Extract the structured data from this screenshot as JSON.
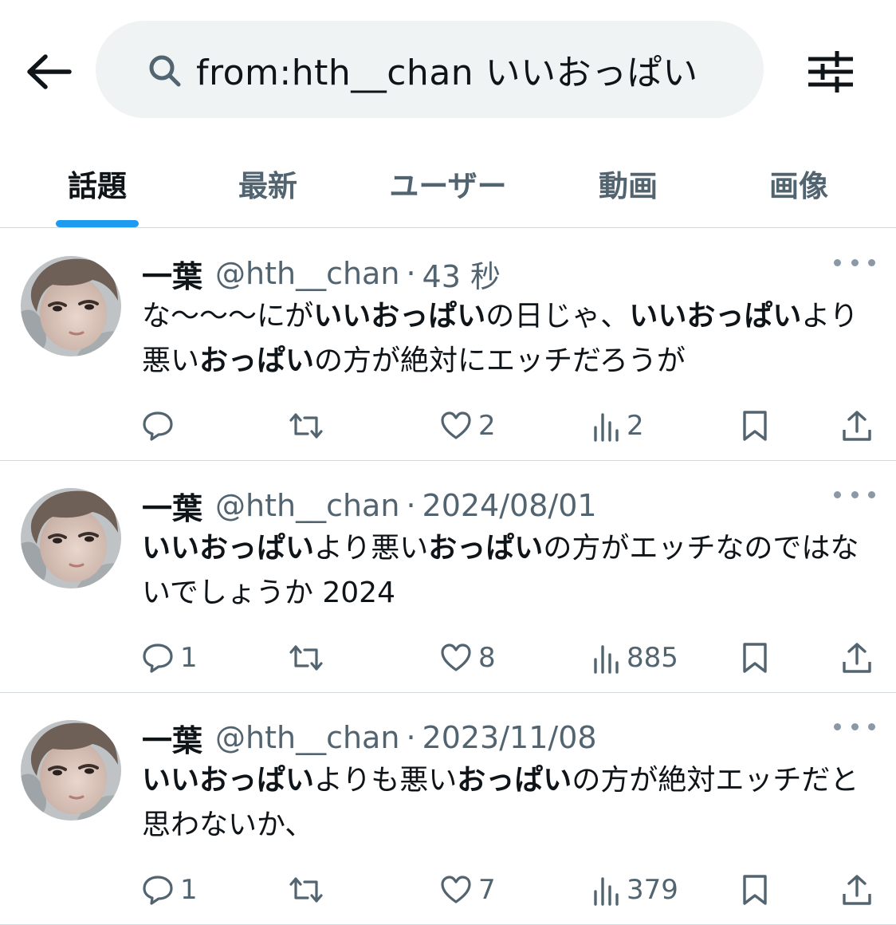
{
  "header": {
    "search_value": "from:hth__chan いいおっぱい"
  },
  "tabs": [
    {
      "label": "話題"
    },
    {
      "label": "最新"
    },
    {
      "label": "ユーザー"
    },
    {
      "label": "動画"
    },
    {
      "label": "画像"
    }
  ],
  "active_tab": "話題",
  "colors": {
    "accent": "#1d9bf0",
    "secondary_text": "#536471",
    "search_bg": "#eff3f4",
    "divider": "#cfd9de"
  },
  "icons": [
    "back-arrow-icon",
    "search-icon",
    "filter-sliders-icon",
    "more-icon",
    "reply-icon",
    "repost-icon",
    "like-icon",
    "views-icon",
    "bookmark-icon",
    "share-icon"
  ],
  "posts": [
    {
      "name": "一葉",
      "handle": "@hth__chan",
      "dot": "·",
      "time": "43 秒",
      "text_segments": [
        {
          "t": "な〜〜〜にが",
          "b": false
        },
        {
          "t": "いいおっぱい",
          "b": true
        },
        {
          "t": "の日じゃ、",
          "b": false
        },
        {
          "t": "いいおっぱい",
          "b": true
        },
        {
          "t": "より悪い",
          "b": false
        },
        {
          "t": "おっぱい",
          "b": true
        },
        {
          "t": "の方が絶対にエッチだろうが",
          "b": false
        }
      ],
      "replies": "",
      "reposts": "",
      "likes": "2",
      "views": "2"
    },
    {
      "name": "一葉",
      "handle": "@hth__chan",
      "dot": "·",
      "time": "2024/08/01",
      "text_segments": [
        {
          "t": "いいおっぱい",
          "b": true
        },
        {
          "t": "より悪い",
          "b": false
        },
        {
          "t": "おっぱい",
          "b": true
        },
        {
          "t": "の方がエッチなのではないでしょうか 2024",
          "b": false
        }
      ],
      "replies": "1",
      "reposts": "",
      "likes": "8",
      "views": "885"
    },
    {
      "name": "一葉",
      "handle": "@hth__chan",
      "dot": "·",
      "time": "2023/11/08",
      "text_segments": [
        {
          "t": "いいおっぱい",
          "b": true
        },
        {
          "t": "よりも悪い",
          "b": false
        },
        {
          "t": "おっぱい",
          "b": true
        },
        {
          "t": "の方が絶対エッチだと思わないか、",
          "b": false
        }
      ],
      "replies": "1",
      "reposts": "",
      "likes": "7",
      "views": "379"
    }
  ]
}
